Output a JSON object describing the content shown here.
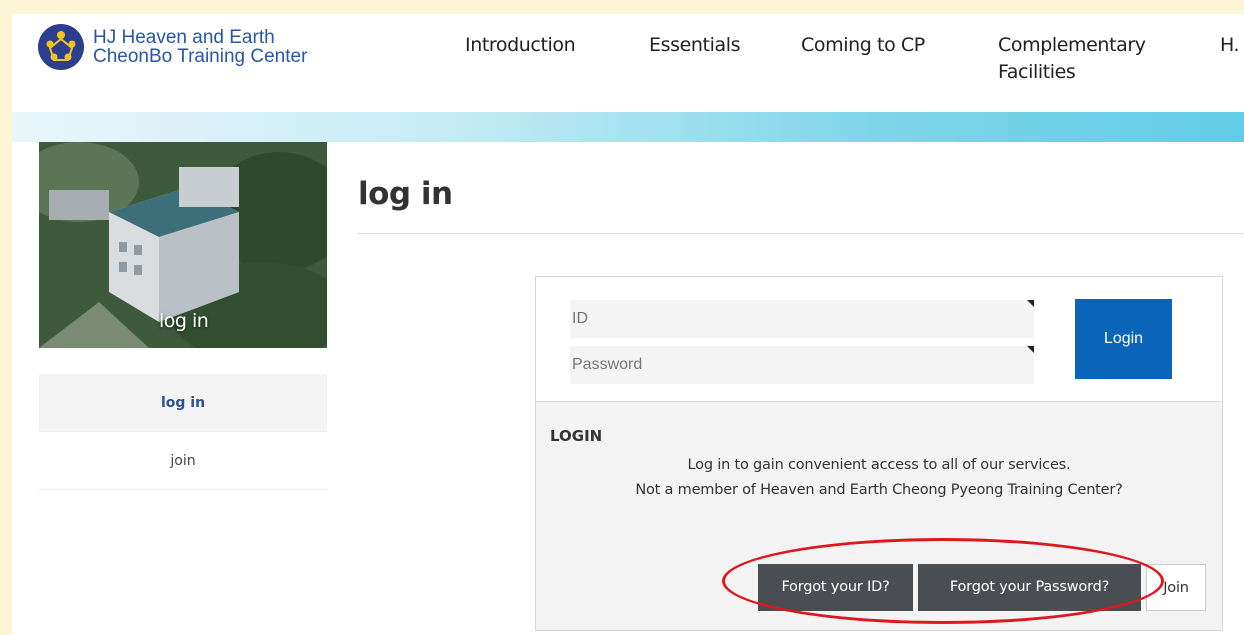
{
  "header": {
    "logo_line1": "HJ Heaven and Earth",
    "logo_line2": "CheonBo Training Center",
    "nav": [
      "Introduction",
      "Essentials",
      "Coming to CP",
      "Complementary Facilities",
      "H."
    ]
  },
  "sidebar": {
    "photo_label": "log in",
    "items": [
      {
        "label": "log in",
        "active": true
      },
      {
        "label": "join",
        "active": false
      }
    ]
  },
  "main": {
    "title": "log in",
    "form": {
      "id_placeholder": "ID",
      "password_placeholder": "Password",
      "login_label": "Login"
    },
    "info": {
      "heading": "LOGIN",
      "line1": "Log in to gain convenient access to all of our services.",
      "line2": "Not a member of Heaven and Earth Cheong Pyeong Training Center?"
    },
    "buttons": {
      "forgot_id": "Forgot your ID?",
      "forgot_password": "Forgot your Password?",
      "join": "Join"
    }
  },
  "colors": {
    "accent_blue": "#0a65b8",
    "dark_button": "#4a4d52",
    "highlight_red": "#e0161d"
  }
}
